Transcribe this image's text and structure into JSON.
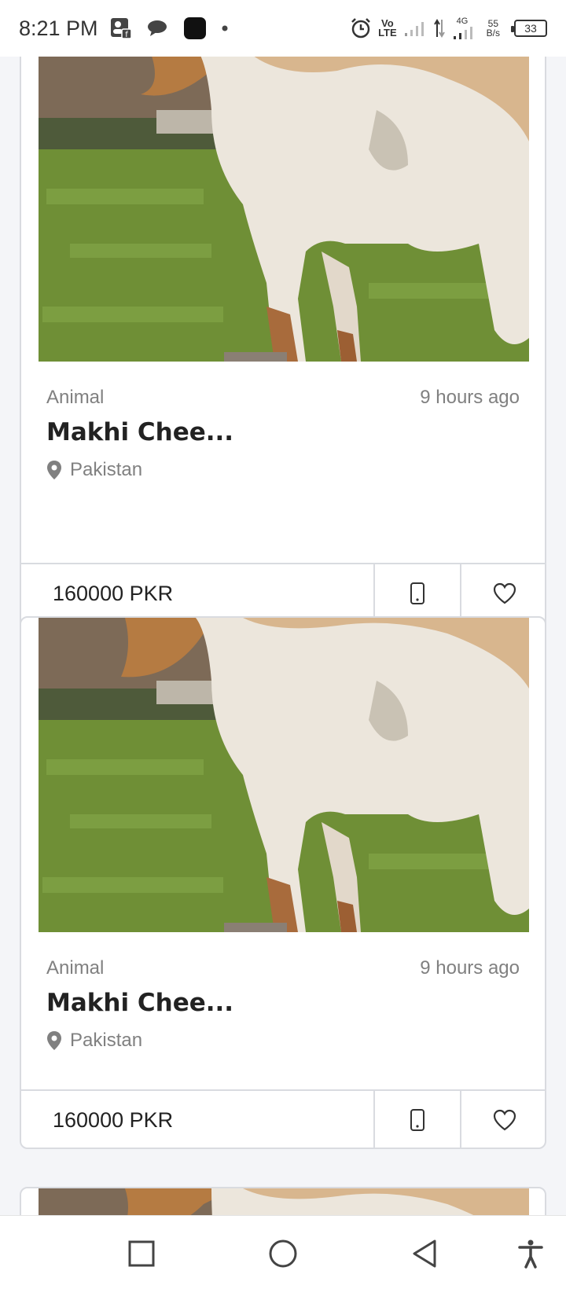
{
  "status_bar": {
    "time": "8:21 PM",
    "network_speed_value": "55",
    "network_speed_unit": "B/s",
    "battery_level": "33",
    "lte_top": "Vo",
    "lte_bottom": "LTE",
    "network_type": "4G"
  },
  "listings": [
    {
      "category": "Animal",
      "posted": "9 hours ago",
      "title": "Makhi Chee...",
      "location": "Pakistan",
      "price": "160000 PKR"
    },
    {
      "category": "Animal",
      "posted": "9 hours ago",
      "title": "Makhi Chee...",
      "location": "Pakistan",
      "price": "160000 PKR"
    }
  ],
  "icons": {
    "call": "phone-icon",
    "favorite": "heart-icon",
    "location": "location-pin-icon",
    "nav_recents": "square-icon",
    "nav_home": "circle-icon",
    "nav_back": "triangle-back-icon",
    "nav_accessibility": "accessibility-icon"
  },
  "colors": {
    "background": "#f4f5f8",
    "card_border": "#d9dbe0",
    "muted_text": "#808080",
    "primary_text": "#222222"
  }
}
